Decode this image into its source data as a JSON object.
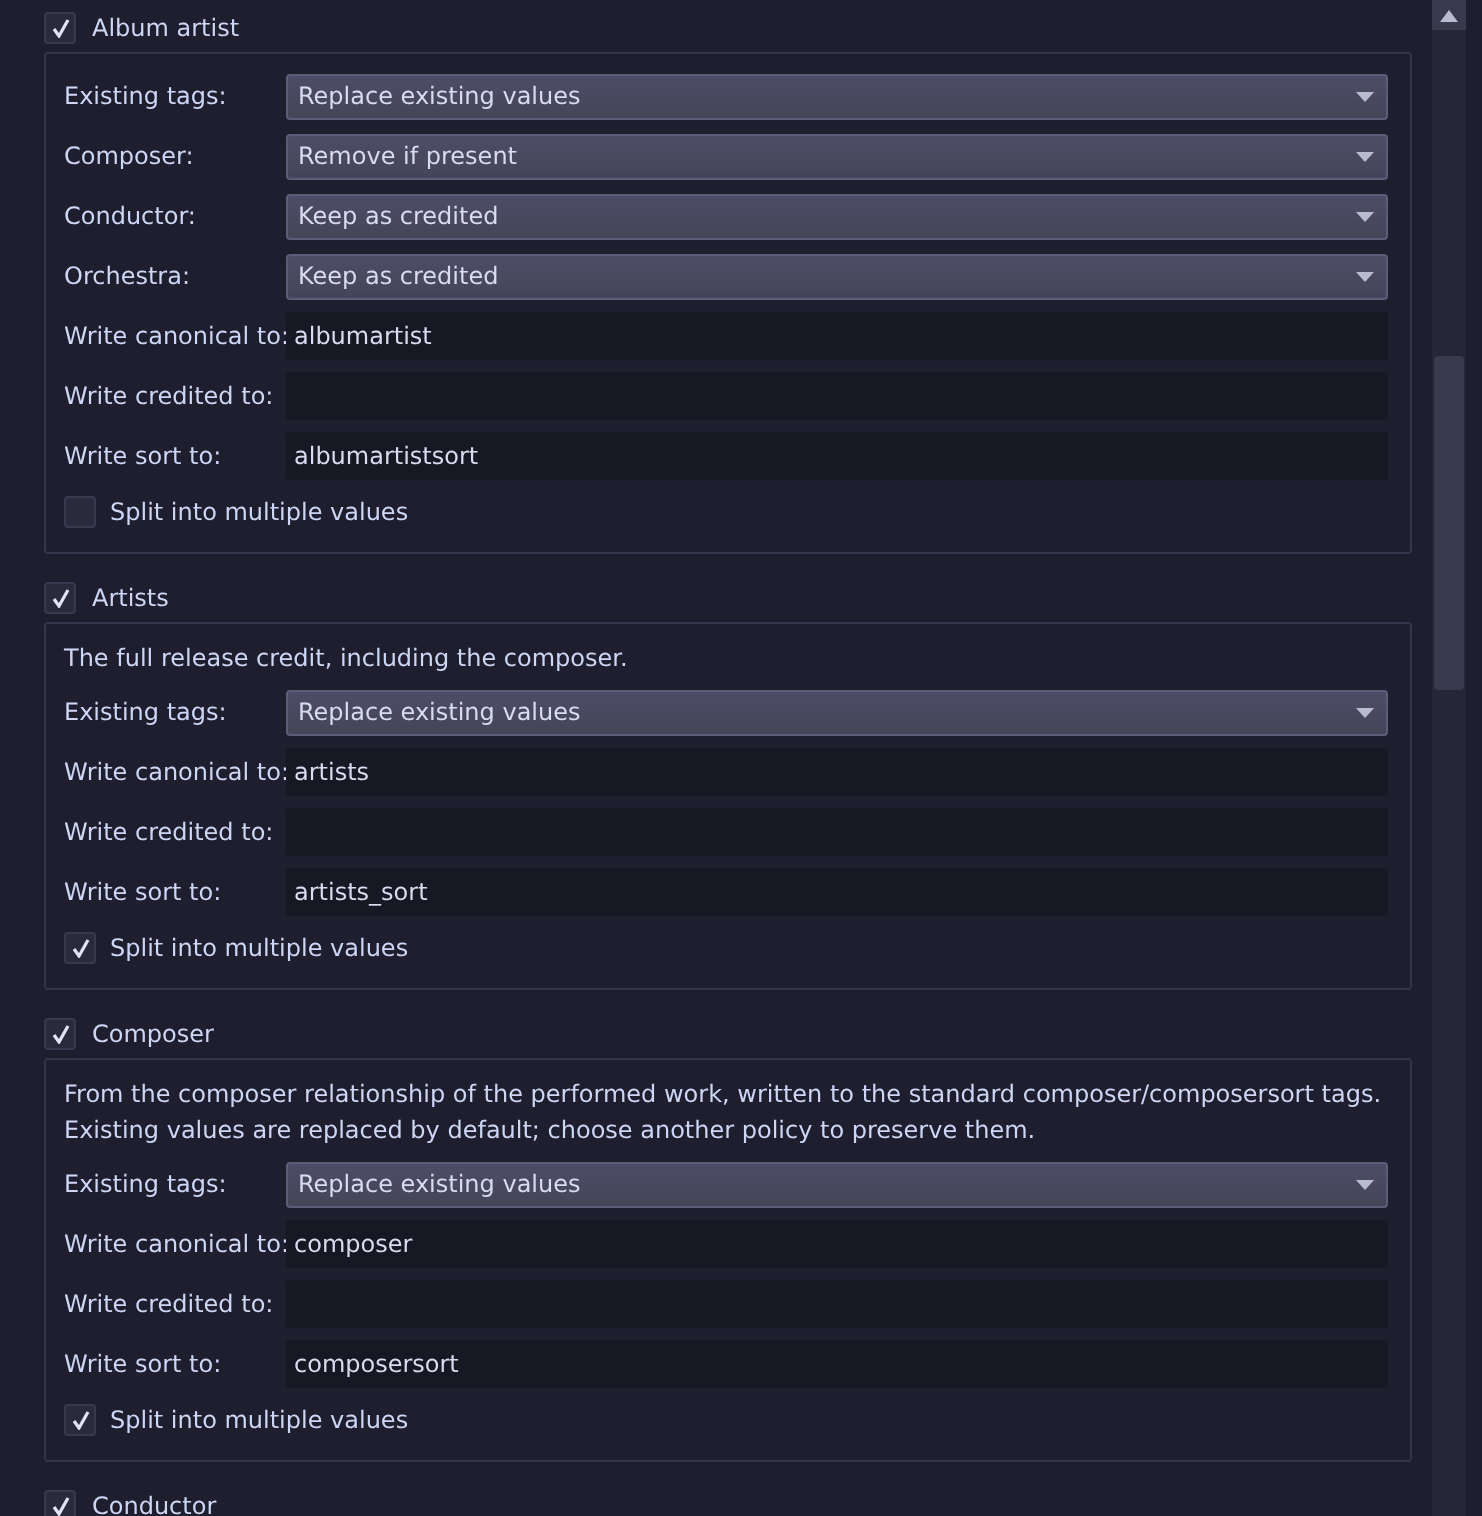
{
  "groups": [
    {
      "title": "Album artist",
      "checked": true,
      "rows": [
        {
          "kind": "combo",
          "label": "Existing tags:",
          "value": "Replace existing values"
        },
        {
          "kind": "combo",
          "label": "Composer:",
          "value": "Remove if present"
        },
        {
          "kind": "combo",
          "label": "Conductor:",
          "value": "Keep as credited"
        },
        {
          "kind": "combo",
          "label": "Orchestra:",
          "value": "Keep as credited"
        },
        {
          "kind": "text",
          "label": "Write canonical to:",
          "value": "albumartist"
        },
        {
          "kind": "text",
          "label": "Write credited to:"
        },
        {
          "kind": "text",
          "label": "Write sort to:",
          "value": "albumartistsort"
        }
      ],
      "split": {
        "label": "Split into multiple values",
        "checked": false
      }
    },
    {
      "title": "Artists",
      "checked": true,
      "description": "The full release credit, including the composer.",
      "rows": [
        {
          "kind": "combo",
          "label": "Existing tags:",
          "value": "Replace existing values"
        },
        {
          "kind": "text",
          "label": "Write canonical to:",
          "value": "artists"
        },
        {
          "kind": "text",
          "label": "Write credited to:"
        },
        {
          "kind": "text",
          "label": "Write sort to:",
          "value": "artists_sort"
        }
      ],
      "split": {
        "label": "Split into multiple values",
        "checked": true
      }
    },
    {
      "title": "Composer",
      "checked": true,
      "description": "From the composer relationship of the performed work, written to the standard composer/composersort tags. Existing values are replaced by default; choose another policy to preserve them.",
      "rows": [
        {
          "kind": "combo",
          "label": "Existing tags:",
          "value": "Replace existing values"
        },
        {
          "kind": "text",
          "label": "Write canonical to:",
          "value": "composer"
        },
        {
          "kind": "text",
          "label": "Write credited to:"
        },
        {
          "kind": "text",
          "label": "Write sort to:",
          "value": "composersort"
        }
      ],
      "split": {
        "label": "Split into multiple values",
        "checked": true
      }
    },
    {
      "title": "Conductor",
      "checked": true
    }
  ]
}
